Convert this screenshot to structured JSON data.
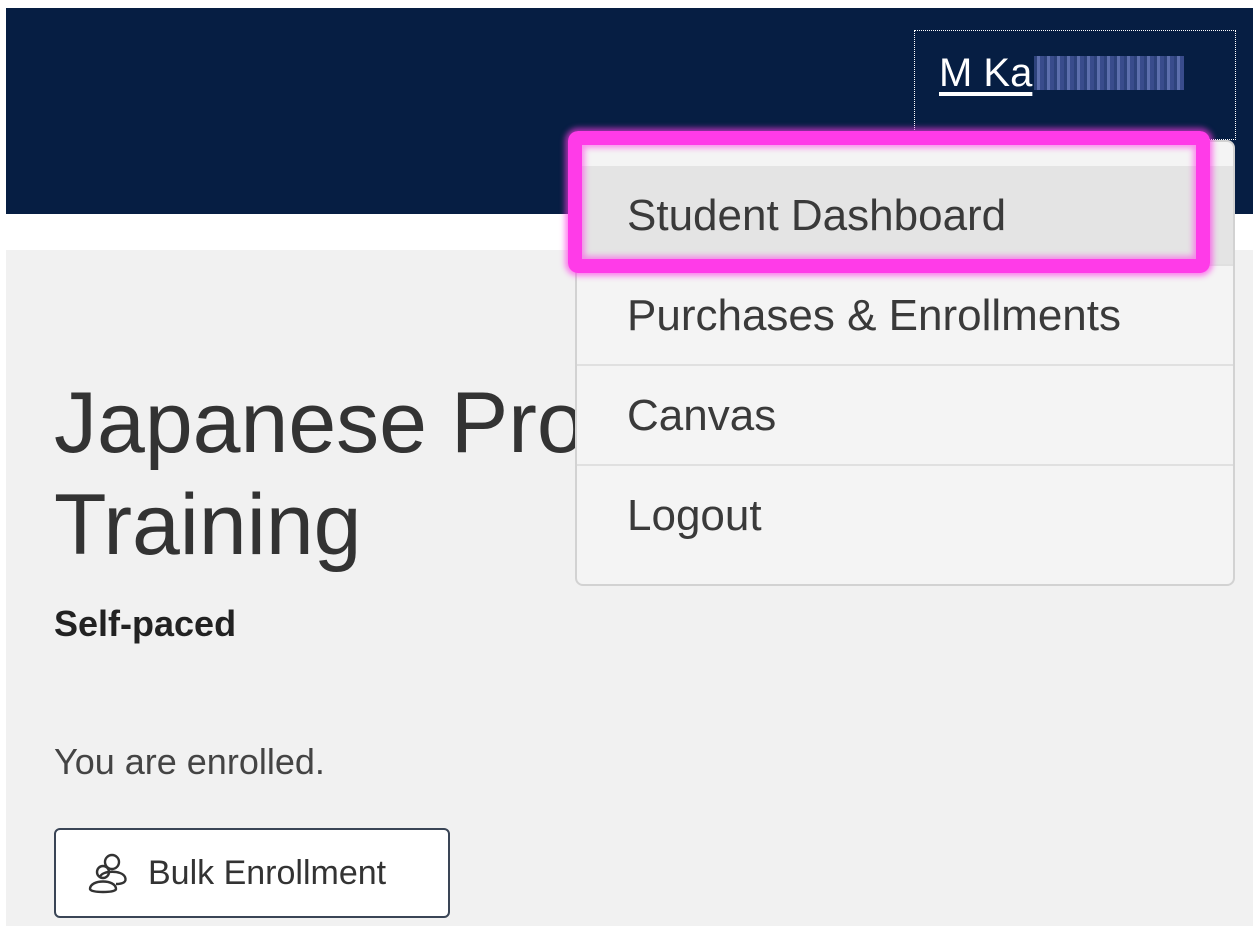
{
  "header": {
    "user_name_visible": "M Ka"
  },
  "dropdown": {
    "items": [
      {
        "label": "Student Dashboard"
      },
      {
        "label": "Purchases & Enrollments"
      },
      {
        "label": "Canvas"
      },
      {
        "label": "Logout"
      }
    ]
  },
  "course": {
    "title_line1": "Japanese Pro",
    "title_line2": "Training",
    "pace": "Self-paced",
    "enrollment_status": "You are enrolled.",
    "bulk_button_label": "Bulk Enrollment",
    "bulk_icon": "users-icon"
  },
  "colors": {
    "header_bg": "#061e43",
    "highlight": "#ff3be8",
    "panel_bg": "#f1f1f1"
  }
}
